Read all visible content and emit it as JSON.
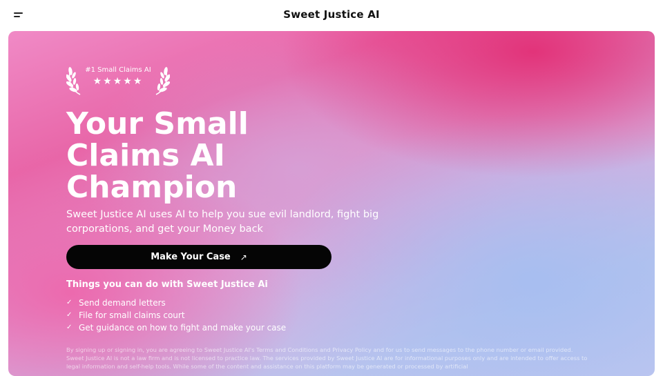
{
  "header": {
    "title": "Sweet Justice AI",
    "menu_icon": "menu-icon"
  },
  "hero": {
    "award": {
      "label": "#1 Small Claims AI",
      "stars": "★★★★★",
      "rating": 5
    },
    "headline": [
      "Your Small",
      "Claims AI",
      "Champion"
    ],
    "subtitle": "Sweet Justice AI uses AI to help you sue evil landlord, fight big corporations, and get your Money back",
    "cta": {
      "label": "Make Your Case",
      "icon": "arrow-up-right-icon"
    },
    "features_title": "Things you can do with Sweet Justice Ai",
    "features": [
      "Send demand letters",
      "File for small claims court",
      "Get guidance on how to fight and make your case"
    ],
    "legal": "By signing up or signing in, you are agreeing to Sweet Justice AI's Terms and Conditions and Privacy Policy and for us to send messages to the phone number or email provided. Sweet Justice AI is not a law firm and is not licensed to practice law. The services provided by Sweet Justice AI are for informational purposes only and are intended to offer access to legal information and self-help tools. While some of the content and assistance on this platform may be generated or processed by artificial"
  },
  "colors": {
    "cta_bg": "#050505",
    "text_light": "#ffffff",
    "hero_pink": "#e866a8",
    "hero_blue": "#b9c4ee"
  }
}
